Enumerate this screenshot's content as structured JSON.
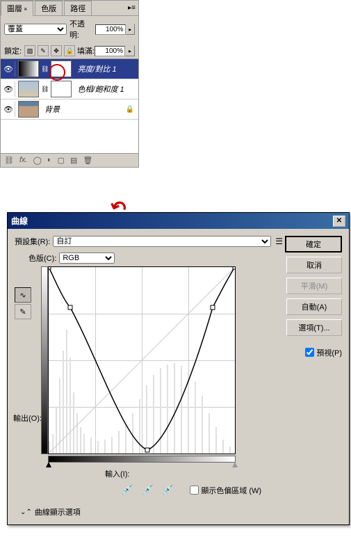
{
  "layers_panel": {
    "tabs": [
      "圖層",
      "色版",
      "路徑"
    ],
    "blend_mode": "覆蓋",
    "opacity_label": "不透明:",
    "opacity_value": "100%",
    "lock_label": "鎖定:",
    "fill_label": "填滿:",
    "fill_value": "100%",
    "layers": [
      {
        "name": "亮度/對比 1",
        "selected": true
      },
      {
        "name": "色相/飽和度 1",
        "selected": false
      },
      {
        "name": "背景",
        "selected": false,
        "locked": true
      }
    ]
  },
  "curves": {
    "title": "曲線",
    "preset_label": "預設集(R):",
    "preset_value": "自訂",
    "channel_label": "色版(C):",
    "channel_value": "RGB",
    "output_label": "輸出(O):",
    "input_label": "輸入(I):",
    "clip_label": "顯示色偏區域 (W)",
    "expand_label": "曲線顯示選項",
    "buttons": {
      "ok": "確定",
      "cancel": "取消",
      "smooth": "平滑(M)",
      "auto": "自動(A)",
      "options": "選項(T)..."
    },
    "preview_label": "預視(P)"
  },
  "chart_data": {
    "type": "line",
    "title": "Curves",
    "xlabel": "Input",
    "ylabel": "Output",
    "xlim": [
      0,
      255
    ],
    "ylim": [
      0,
      255
    ],
    "series": [
      {
        "name": "RGB curve",
        "points": [
          {
            "x": 0,
            "y": 255
          },
          {
            "x": 30,
            "y": 200
          },
          {
            "x": 135,
            "y": 5
          },
          {
            "x": 225,
            "y": 200
          },
          {
            "x": 255,
            "y": 255
          }
        ]
      }
    ],
    "histogram_note": "background histogram present, values not individually readable"
  }
}
